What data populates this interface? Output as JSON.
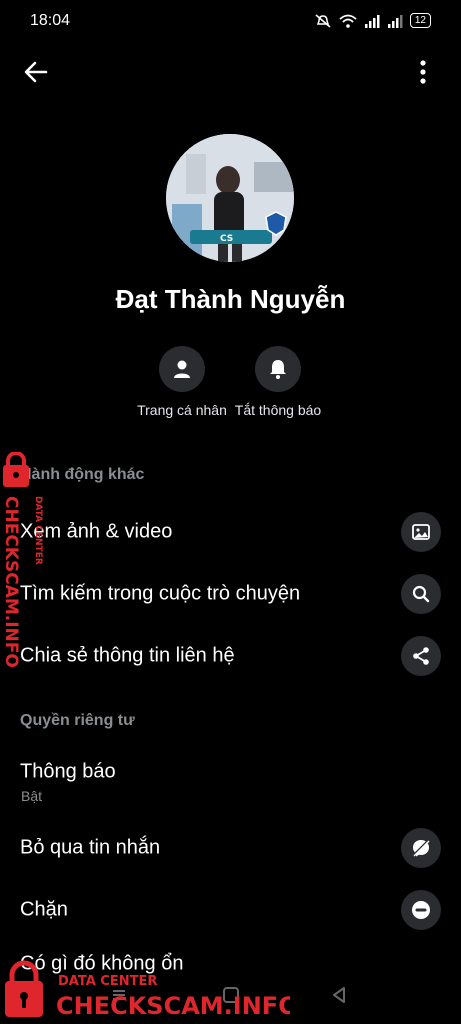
{
  "status": {
    "time": "18:04",
    "battery": "12"
  },
  "profile": {
    "name": "Đạt Thành Nguyễn"
  },
  "quick_actions": [
    {
      "label": "Trang cá nhân",
      "icon": "person-icon"
    },
    {
      "label": "Tắt thông báo",
      "icon": "bell-icon"
    }
  ],
  "sections": {
    "other_actions": "Hành động khác",
    "privacy": "Quyền riêng tư"
  },
  "other_actions": [
    {
      "label": "Xem ảnh & video",
      "icon": "image-icon"
    },
    {
      "label": "Tìm kiếm trong cuộc trò chuyện",
      "icon": "search-icon"
    },
    {
      "label": "Chia sẻ thông tin liên hệ",
      "icon": "share-icon"
    }
  ],
  "privacy": {
    "notifications": {
      "label": "Thông báo",
      "sub": "Bật"
    },
    "ignore": {
      "label": "Bỏ qua tin nhắn",
      "icon": "ignore-icon"
    },
    "block": {
      "label": "Chặn",
      "icon": "block-icon"
    },
    "report": {
      "label": "Có gì đó không ổn"
    }
  },
  "watermark": {
    "top": "DATA CENTER",
    "main": "CHECKSCAM.INFO"
  },
  "colors": {
    "background": "#000000",
    "circle": "#2b2c2f",
    "muted": "#8a8d91",
    "watermark": "#e0262d"
  }
}
